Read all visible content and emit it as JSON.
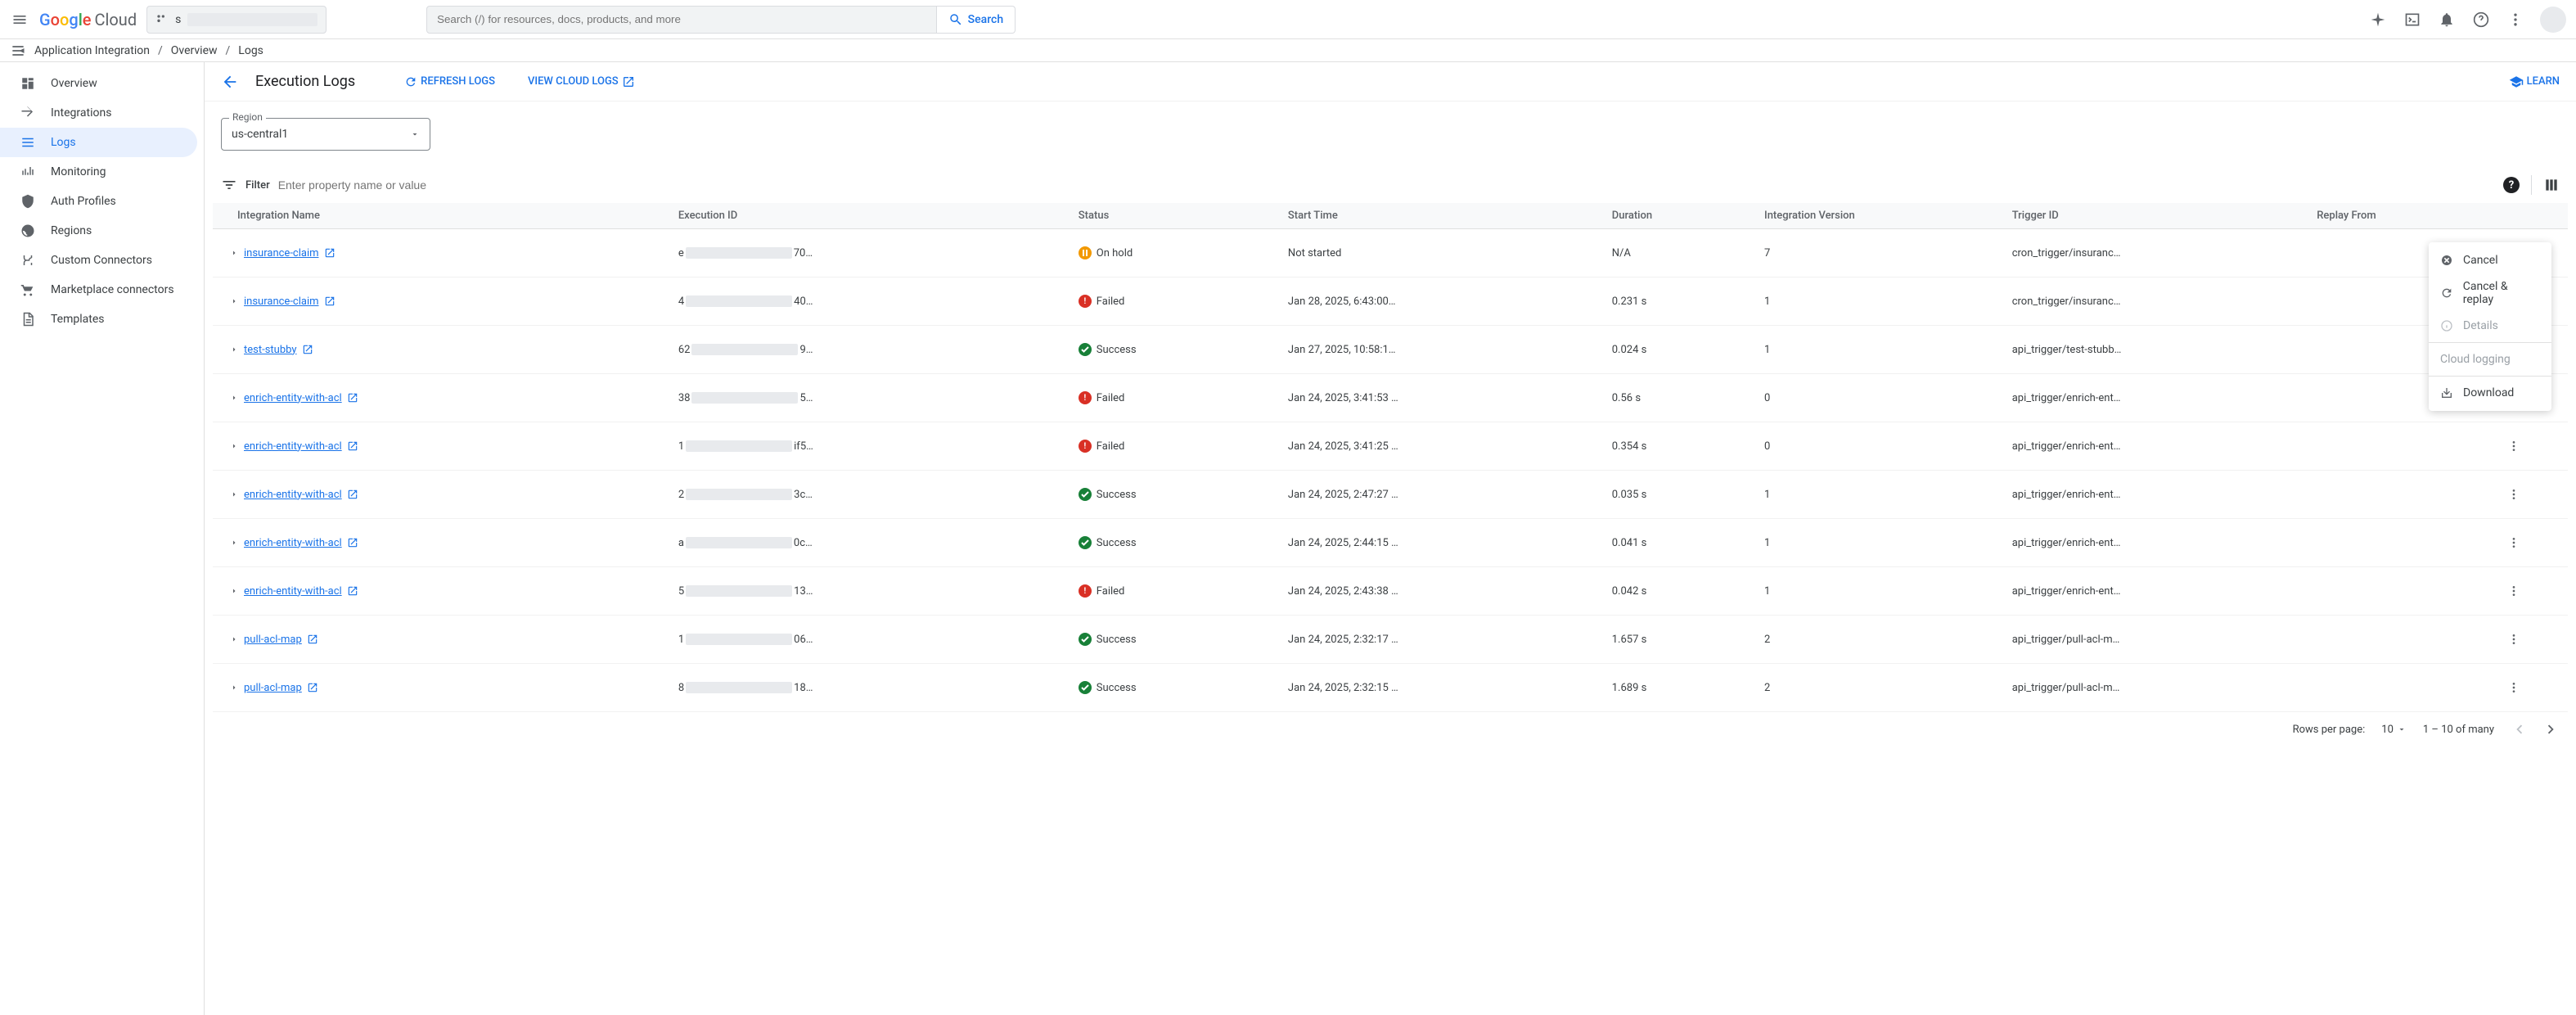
{
  "header": {
    "logo_cloud": "Cloud",
    "project_prefix": "s",
    "search_placeholder": "Search (/) for resources, docs, products, and more",
    "search_button": "Search"
  },
  "breadcrumb": {
    "product": "Application Integration",
    "overview": "Overview",
    "page": "Logs"
  },
  "sidebar": {
    "items": [
      {
        "label": "Overview",
        "icon": "overview"
      },
      {
        "label": "Integrations",
        "icon": "integrations"
      },
      {
        "label": "Logs",
        "icon": "logs",
        "active": true
      },
      {
        "label": "Monitoring",
        "icon": "monitoring"
      },
      {
        "label": "Auth Profiles",
        "icon": "auth"
      },
      {
        "label": "Regions",
        "icon": "regions"
      },
      {
        "label": "Custom Connectors",
        "icon": "connectors"
      },
      {
        "label": "Marketplace connectors",
        "icon": "marketplace"
      },
      {
        "label": "Templates",
        "icon": "templates"
      }
    ]
  },
  "page": {
    "title": "Execution Logs",
    "refresh": "REFRESH LOGS",
    "cloud_logs": "VIEW CLOUD LOGS",
    "learn": "LEARN"
  },
  "region": {
    "label": "Region",
    "value": "us-central1"
  },
  "filter": {
    "label": "Filter",
    "placeholder": "Enter property name or value"
  },
  "table": {
    "headers": {
      "name": "Integration Name",
      "exec": "Execution ID",
      "status": "Status",
      "start": "Start Time",
      "duration": "Duration",
      "version": "Integration Version",
      "trigger": "Trigger ID",
      "replay": "Replay From"
    },
    "rows": [
      {
        "name": "insurance-claim",
        "exec_pre": "e",
        "exec_suf": "70…",
        "status": "On hold",
        "status_type": "onhold",
        "start": "Not started",
        "duration": "N/A",
        "version": "7",
        "trigger": "cron_trigger/insuranc…"
      },
      {
        "name": "insurance-claim",
        "exec_pre": "4",
        "exec_suf": "40…",
        "status": "Failed",
        "status_type": "failed",
        "start": "Jan 28, 2025, 6:43:00…",
        "duration": "0.231 s",
        "version": "1",
        "trigger": "cron_trigger/insuranc…"
      },
      {
        "name": "test-stubby",
        "exec_pre": "62",
        "exec_suf": "9…",
        "status": "Success",
        "status_type": "success",
        "start": "Jan 27, 2025, 10:58:1…",
        "duration": "0.024 s",
        "version": "1",
        "trigger": "api_trigger/test-stubb…"
      },
      {
        "name": "enrich-entity-with-acl",
        "exec_pre": "38",
        "exec_suf": "5…",
        "status": "Failed",
        "status_type": "failed",
        "start": "Jan 24, 2025, 3:41:53 …",
        "duration": "0.56 s",
        "version": "0",
        "trigger": "api_trigger/enrich-ent…"
      },
      {
        "name": "enrich-entity-with-acl",
        "exec_pre": "1",
        "exec_suf": "if5…",
        "status": "Failed",
        "status_type": "failed",
        "start": "Jan 24, 2025, 3:41:25 …",
        "duration": "0.354 s",
        "version": "0",
        "trigger": "api_trigger/enrich-ent…"
      },
      {
        "name": "enrich-entity-with-acl",
        "exec_pre": "2",
        "exec_suf": "3c…",
        "status": "Success",
        "status_type": "success",
        "start": "Jan 24, 2025, 2:47:27 …",
        "duration": "0.035 s",
        "version": "1",
        "trigger": "api_trigger/enrich-ent…"
      },
      {
        "name": "enrich-entity-with-acl",
        "exec_pre": "a",
        "exec_suf": "0c…",
        "status": "Success",
        "status_type": "success",
        "start": "Jan 24, 2025, 2:44:15 …",
        "duration": "0.041 s",
        "version": "1",
        "trigger": "api_trigger/enrich-ent…"
      },
      {
        "name": "enrich-entity-with-acl",
        "exec_pre": "5",
        "exec_suf": "13…",
        "status": "Failed",
        "status_type": "failed",
        "start": "Jan 24, 2025, 2:43:38 …",
        "duration": "0.042 s",
        "version": "1",
        "trigger": "api_trigger/enrich-ent…"
      },
      {
        "name": "pull-acl-map",
        "exec_pre": "1",
        "exec_suf": "06…",
        "status": "Success",
        "status_type": "success",
        "start": "Jan 24, 2025, 2:32:17 …",
        "duration": "1.657 s",
        "version": "2",
        "trigger": "api_trigger/pull-acl-m…"
      },
      {
        "name": "pull-acl-map",
        "exec_pre": "8",
        "exec_suf": "18…",
        "status": "Success",
        "status_type": "success",
        "start": "Jan 24, 2025, 2:32:15 …",
        "duration": "1.689 s",
        "version": "2",
        "trigger": "api_trigger/pull-acl-m…"
      }
    ]
  },
  "menu": {
    "cancel": "Cancel",
    "cancel_replay": "Cancel & replay",
    "details": "Details",
    "cloud_logging": "Cloud logging",
    "download": "Download"
  },
  "pagination": {
    "rows_label": "Rows per page:",
    "rows_value": "10",
    "range": "1 – 10 of many"
  }
}
